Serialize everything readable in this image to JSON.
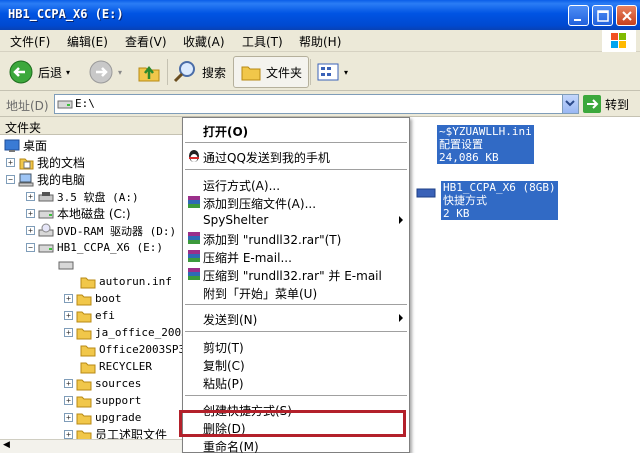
{
  "window": {
    "title": "HB1_CCPA_X6 (E:)"
  },
  "menubar": {
    "items": [
      "文件(F)",
      "编辑(E)",
      "查看(V)",
      "收藏(A)",
      "工具(T)",
      "帮助(H)"
    ]
  },
  "toolbar": {
    "back_label": "后退",
    "search_label": "搜索",
    "folders_label": "文件夹"
  },
  "addressbar": {
    "label": "地址(D)",
    "value": "E:\\",
    "go_label": "转到"
  },
  "leftpane": {
    "header": "文件夹",
    "tree": [
      {
        "label": "桌面"
      },
      {
        "label": "我的文档"
      },
      {
        "label": "我的电脑"
      },
      {
        "label": "3.5 软盘 (A:)"
      },
      {
        "label": "本地磁盘 (C:)"
      },
      {
        "label": "DVD-RAM 驱动器 (D:)"
      },
      {
        "label": "HB1_CCPA_X6 (E:)"
      },
      {
        "label": ""
      },
      {
        "label": "autorun.inf"
      },
      {
        "label": "boot"
      },
      {
        "label": "efi"
      },
      {
        "label": "ja_office_2003"
      },
      {
        "label": "Office2003SP3_"
      },
      {
        "label": "RECYCLER"
      },
      {
        "label": "sources"
      },
      {
        "label": "support"
      },
      {
        "label": "upgrade"
      },
      {
        "label": "员工述职文件"
      }
    ]
  },
  "rightpane": {
    "file1": {
      "name": "~$YZUAWLLH.ini",
      "type": "配置设置",
      "size": "24,086 KB"
    },
    "file2": {
      "name": "HB1_CCPA_X6 (8GB)",
      "type": "快捷方式",
      "size": "2 KB"
    }
  },
  "contextmenu": {
    "items": [
      "打开(O)",
      "通过QQ发送到我的手机",
      "运行方式(A)...",
      "添加到压缩文件(A)...",
      "SpyShelter",
      "添加到 \"rundll32.rar\"(T)",
      "压缩并 E-mail...",
      "压缩到 \"rundll32.rar\" 并 E-mail",
      "附到「开始」菜单(U)",
      "发送到(N)",
      "剪切(T)",
      "复制(C)",
      "粘贴(P)",
      "创建快捷方式(S)",
      "删除(D)",
      "重命名(M)"
    ]
  }
}
